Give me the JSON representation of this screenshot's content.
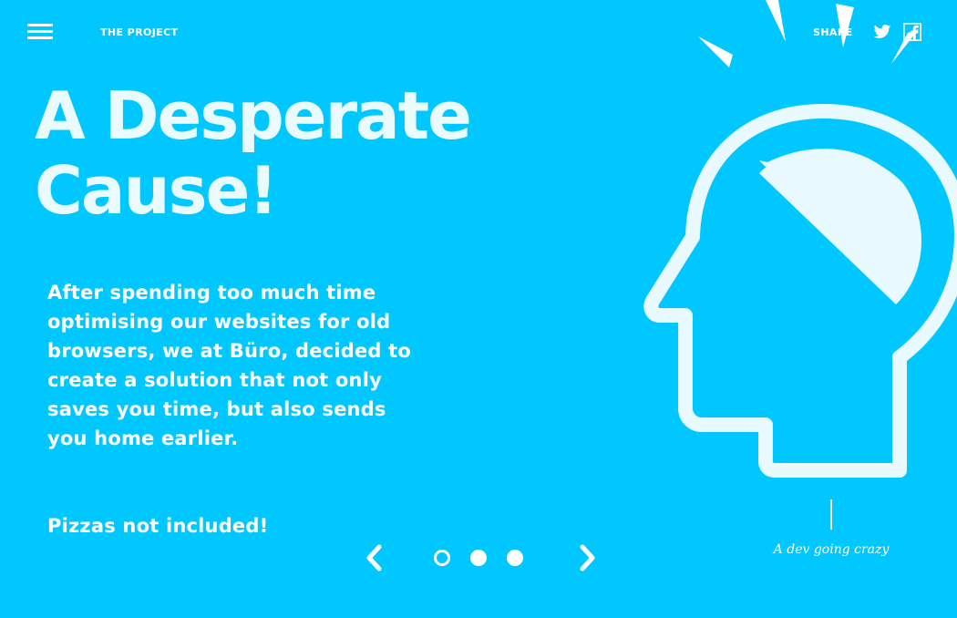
{
  "header": {
    "menu_icon": "hamburger-menu-icon",
    "nav_link": "THE PROJECT",
    "share_label": "SHARE",
    "share_icons": [
      "twitter-icon",
      "facebook-icon"
    ]
  },
  "hero": {
    "title_line1": "A Desperate",
    "title_line2": "Cause!",
    "body": "After spending too much time optimising our websites for old browsers, we at Büro, decided to create a solution that not only saves you time, but also sends you home earlier.",
    "tagline": "Pizzas not included!"
  },
  "slider": {
    "prev_icon": "chevron-left-icon",
    "next_icon": "chevron-right-icon",
    "current": 1,
    "total": 3
  },
  "illustration": {
    "icon": "head-silhouette-icon",
    "caption": "A dev going crazy"
  },
  "colors": {
    "background": "#00c8ff",
    "foreground": "#ffffff",
    "title": "#eafbff"
  }
}
